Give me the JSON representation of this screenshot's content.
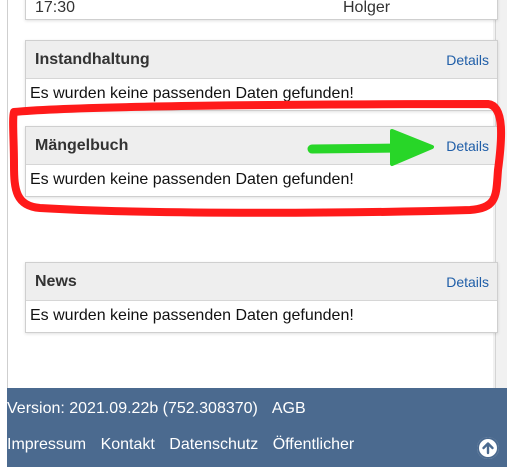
{
  "top_row": {
    "time": "17:30",
    "name": "Holger"
  },
  "panels": [
    {
      "title": "Instandhaltung",
      "details": "Details",
      "message": "Es wurden keine passenden Daten gefunden!"
    },
    {
      "title": "Mängelbuch",
      "details": "Details",
      "message": "Es wurden keine passenden Daten gefunden!"
    },
    {
      "title": "News",
      "details": "Details",
      "message": "Es wurden keine passenden Daten gefunden!"
    }
  ],
  "annotation_colors": {
    "ellipse": "#ff1a1a",
    "arrow": "#28d628"
  },
  "footer": {
    "version": "Version: 2021.09.22b (752.308370)",
    "agb": "AGB",
    "impressum": "Impressum",
    "kontakt": "Kontakt",
    "datenschutz": "Datenschutz",
    "oeffentlicher": "Öffentlicher",
    "bg_color": "#4b6a8f"
  }
}
